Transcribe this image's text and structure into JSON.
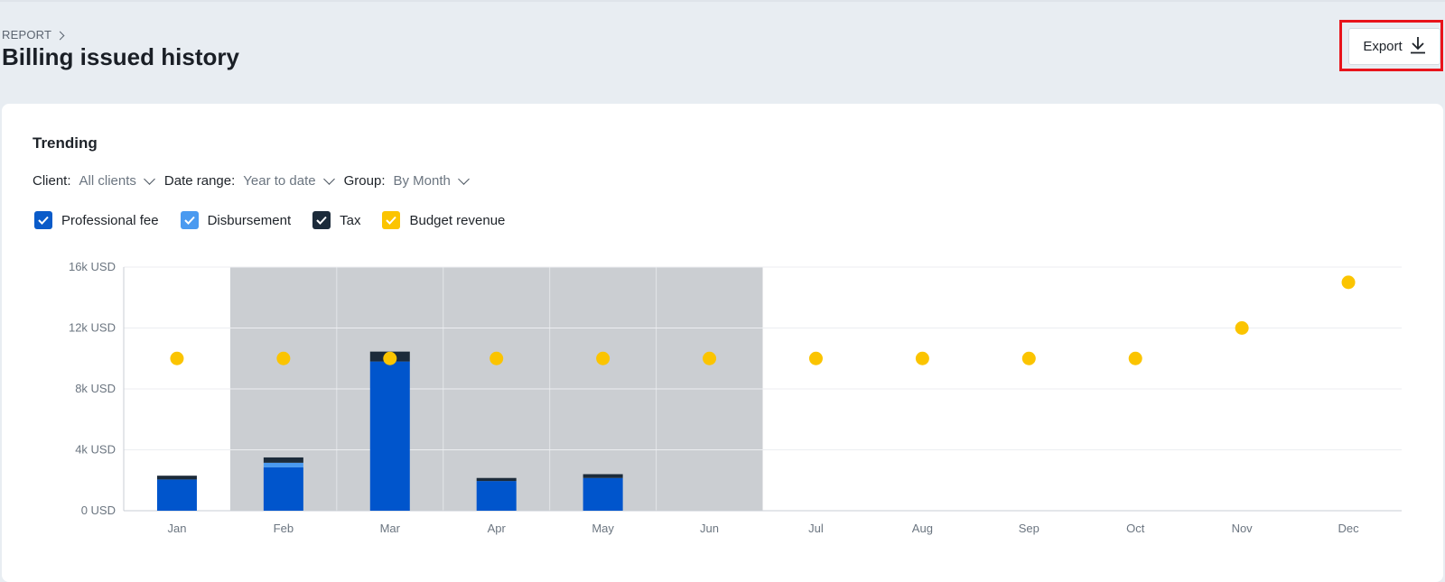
{
  "header": {
    "breadcrumb": "REPORT",
    "title": "Billing issued history",
    "export_label": "Export"
  },
  "section": {
    "title": "Trending"
  },
  "filters": {
    "client": {
      "label": "Client:",
      "value": "All clients"
    },
    "date_range": {
      "label": "Date range:",
      "value": "Year to date"
    },
    "group": {
      "label": "Group:",
      "value": "By Month"
    }
  },
  "legend": [
    {
      "label": "Professional fee",
      "color": "#0a5bc9",
      "checked": true
    },
    {
      "label": "Disbursement",
      "color": "#4a9af0",
      "checked": true
    },
    {
      "label": "Tax",
      "color": "#1c2b3a",
      "checked": true
    },
    {
      "label": "Budget revenue",
      "color": "#fbc400",
      "checked": true
    }
  ],
  "chart_data": {
    "type": "bar",
    "stacked": true,
    "categories": [
      "Jan",
      "Feb",
      "Mar",
      "Apr",
      "May",
      "Jun",
      "Jul",
      "Aug",
      "Sep",
      "Oct",
      "Nov",
      "Dec"
    ],
    "y_tick_labels": [
      "0 USD",
      "4k USD",
      "8k USD",
      "12k USD",
      "16k USD"
    ],
    "ylim": [
      0,
      16000
    ],
    "highlighted_months": [
      "Feb",
      "Mar",
      "Apr",
      "May",
      "Jun"
    ],
    "series": [
      {
        "name": "Professional fee",
        "kind": "bar",
        "color": "#0055cc",
        "values": [
          2050,
          2850,
          9800,
          1950,
          2150,
          0,
          0,
          0,
          0,
          0,
          0,
          0
        ]
      },
      {
        "name": "Disbursement",
        "kind": "bar",
        "color": "#4a9af0",
        "values": [
          0,
          300,
          0,
          0,
          0,
          0,
          0,
          0,
          0,
          0,
          0,
          0
        ]
      },
      {
        "name": "Tax",
        "kind": "bar",
        "color": "#1c2b3a",
        "values": [
          250,
          350,
          650,
          200,
          250,
          0,
          0,
          0,
          0,
          0,
          0,
          0
        ]
      },
      {
        "name": "Budget revenue",
        "kind": "point",
        "color": "#fbc400",
        "values": [
          10000,
          10000,
          10000,
          10000,
          10000,
          10000,
          10000,
          10000,
          10000,
          10000,
          12000,
          15000
        ]
      }
    ],
    "grid": true
  }
}
